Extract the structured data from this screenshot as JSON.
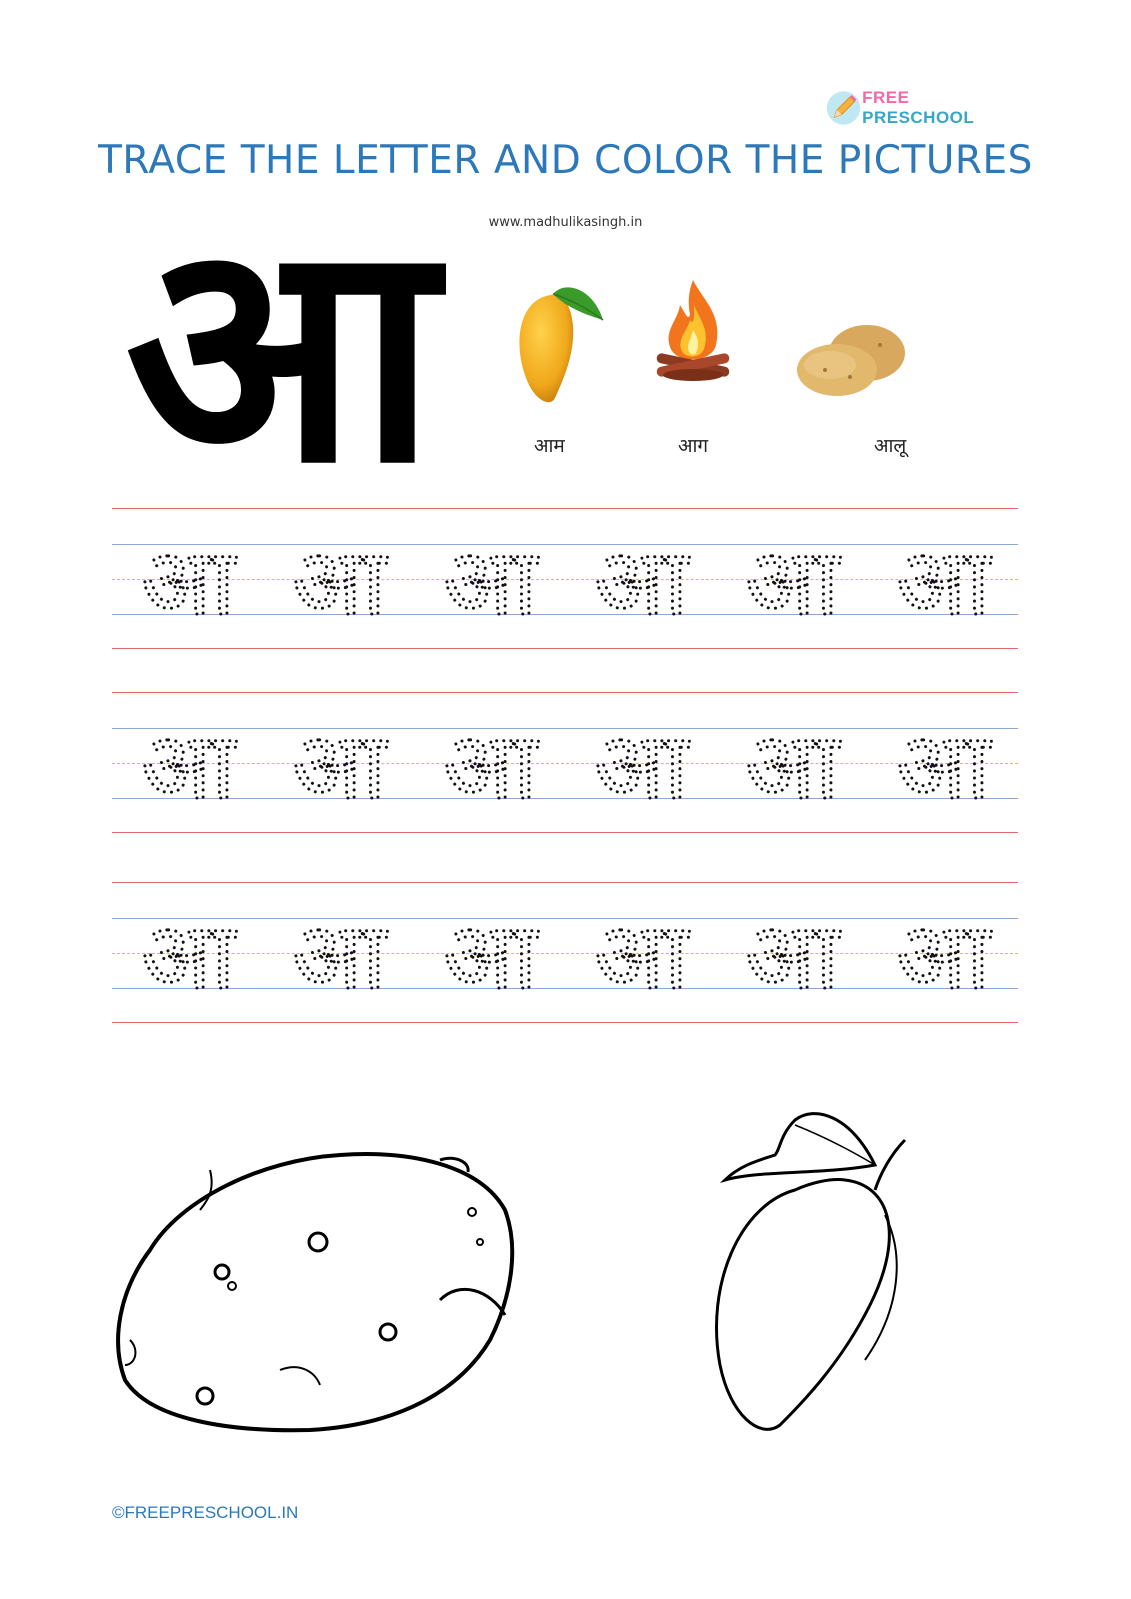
{
  "logo": {
    "word1": "FREE",
    "word2": "PRESCHOOL",
    "icon": "pencil-circle-icon"
  },
  "title": "TRACE THE LETTER AND COLOR THE PICTURES",
  "website": "www.madhulikasingh.in",
  "letter": "आ",
  "pictures": [
    {
      "icon": "mango-icon",
      "word": "आम"
    },
    {
      "icon": "bonfire-icon",
      "word": "आग"
    },
    {
      "icon": "potato-icon",
      "word": "आलू"
    }
  ],
  "tracing": {
    "letter": "आ",
    "rows": 3,
    "letters_per_row": 6,
    "colors": {
      "red_line": "#e06a6a",
      "blue_line": "#8ba7d8",
      "mid_line": "#d9b870"
    }
  },
  "coloring": [
    {
      "icon": "potato-outline-icon"
    },
    {
      "icon": "mango-outline-icon"
    }
  ],
  "footer": "©FREEPRESCHOOL.IN"
}
